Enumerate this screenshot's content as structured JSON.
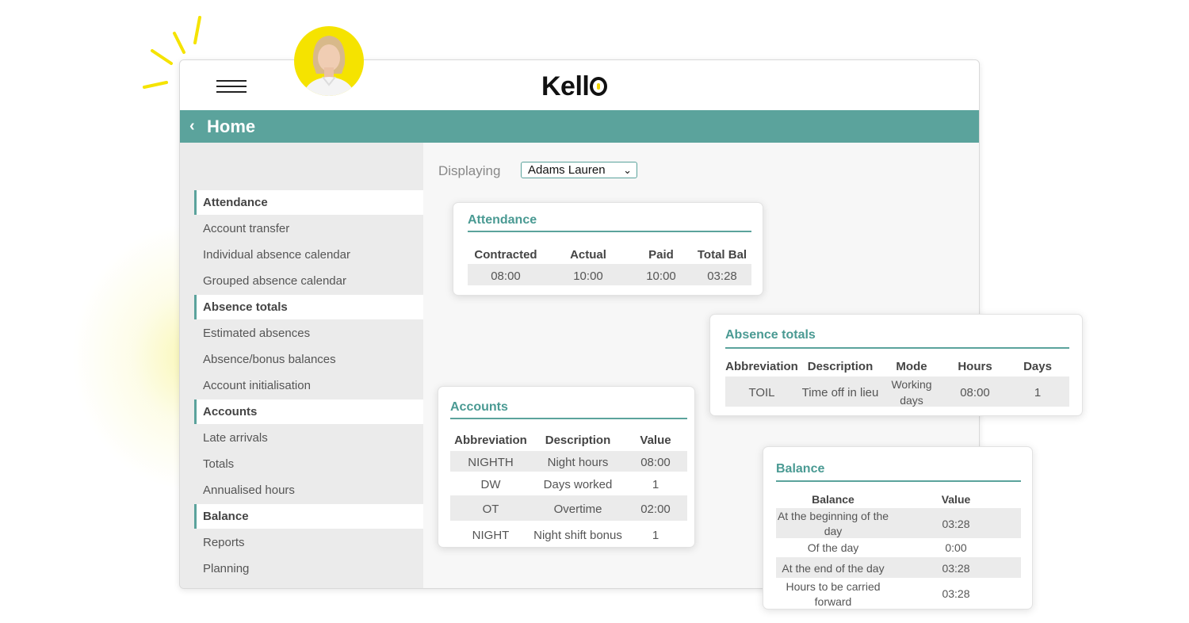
{
  "app": {
    "logo_text": "Kell",
    "title": "Home"
  },
  "filter": {
    "label": "Displaying",
    "selected": "Adams Lauren"
  },
  "sidebar": {
    "items": [
      {
        "label": "Attendance",
        "header": true
      },
      {
        "label": "Account transfer"
      },
      {
        "label": "Individual absence calendar"
      },
      {
        "label": "Grouped absence calendar"
      },
      {
        "label": "Absence totals",
        "header": true
      },
      {
        "label": "Estimated absences"
      },
      {
        "label": "Absence/bonus balances"
      },
      {
        "label": "Account initialisation"
      },
      {
        "label": "Accounts",
        "header": true
      },
      {
        "label": "Late arrivals"
      },
      {
        "label": "Totals"
      },
      {
        "label": "Annualised hours"
      },
      {
        "label": "Balance",
        "header": true
      },
      {
        "label": "Reports"
      },
      {
        "label": "Planning"
      }
    ]
  },
  "attendance": {
    "title": "Attendance",
    "headers": [
      "Contracted",
      "Actual",
      "Paid",
      "Total Bal"
    ],
    "row": [
      "08:00",
      "10:00",
      "10:00",
      "03:28"
    ]
  },
  "absence_totals": {
    "title": "Absence totals",
    "headers": [
      "Abbreviation",
      "Description",
      "Mode",
      "Hours",
      "Days"
    ],
    "row": [
      "TOIL",
      "Time off in lieu",
      "Working",
      "days",
      "08:00",
      "1"
    ]
  },
  "accounts": {
    "title": "Accounts",
    "headers": [
      "Abbreviation",
      "Description",
      "Value"
    ],
    "rows": [
      [
        "NIGHTH",
        "Night hours",
        "08:00"
      ],
      [
        "DW",
        "Days worked",
        "1"
      ],
      [
        "OT",
        "Overtime",
        "02:00"
      ],
      [
        "NIGHT",
        "Night shift bonus",
        "1"
      ]
    ]
  },
  "balance": {
    "title": "Balance",
    "headers": [
      "Balance",
      "Value"
    ],
    "rows": [
      [
        "At the beginning of the",
        "day",
        "03:28"
      ],
      [
        "Of the day",
        "",
        "0:00"
      ],
      [
        "At the end of the day",
        "",
        "03:28"
      ],
      [
        "Hours to be carried",
        "forward",
        "03:28"
      ]
    ]
  },
  "colors": {
    "accent": "#5ba39c",
    "logo_dot": "#f2d500",
    "avatar_ring": "#f5e300"
  }
}
